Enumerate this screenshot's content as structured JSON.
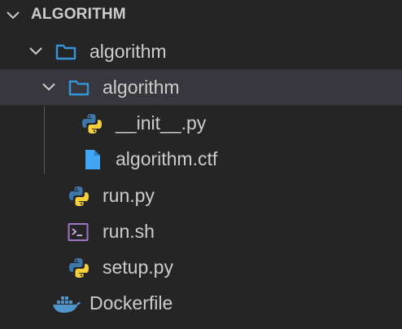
{
  "explorer": {
    "section_title": "ALGORITHM",
    "items": [
      {
        "label": "algorithm",
        "type": "folder",
        "expanded": true
      },
      {
        "label": "algorithm",
        "type": "folder",
        "expanded": true,
        "selected": true
      },
      {
        "label": "__init__.py",
        "type": "python-file"
      },
      {
        "label": "algorithm.ctf",
        "type": "file"
      },
      {
        "label": "run.py",
        "type": "python-file"
      },
      {
        "label": "run.sh",
        "type": "shell-file"
      },
      {
        "label": "setup.py",
        "type": "python-file"
      },
      {
        "label": "Dockerfile",
        "type": "docker-file"
      }
    ]
  },
  "colors": {
    "background": "#252526",
    "selected_row": "#37373d",
    "text": "#cccccc",
    "folder_icon": "#3794d6",
    "file_icon": "#42a5f5",
    "python_blue": "#3f76a8",
    "python_yellow": "#f5cf3c",
    "shell_icon": "#a074c4",
    "docker_icon": "#4f95c9"
  }
}
